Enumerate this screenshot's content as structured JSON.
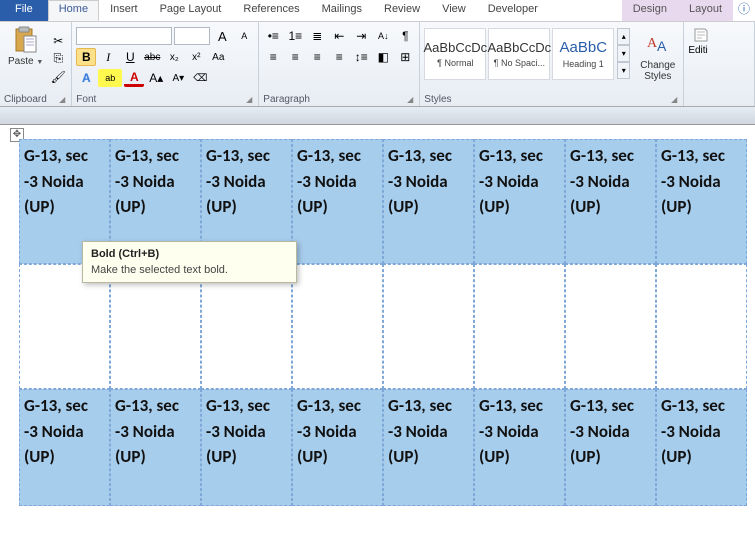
{
  "tabs": {
    "file": "File",
    "items": [
      "Home",
      "Insert",
      "Page Layout",
      "References",
      "Mailings",
      "Review",
      "View",
      "Developer"
    ],
    "context": [
      "Design",
      "Layout"
    ],
    "active": "Home",
    "help": "ⓘ"
  },
  "ribbon": {
    "clipboard": {
      "label": "Clipboard",
      "paste": "Paste",
      "cut": "✂",
      "copy": "⎘",
      "painter": "🖌"
    },
    "font": {
      "label": "Font",
      "name": "",
      "size": "",
      "grow": "A",
      "shrink": "A",
      "case": "Aa",
      "clear": "⌫",
      "bold": "B",
      "italic": "I",
      "underline": "U",
      "strike": "abc",
      "sub": "x₂",
      "sup": "x²",
      "effects": "A",
      "highlight": "ab",
      "color": "A"
    },
    "paragraph": {
      "label": "Paragraph",
      "bullets": "•≡",
      "numbers": "1≡",
      "multilevel": "≣",
      "dedent": "⇤",
      "indent": "⇥",
      "sort": "A↓",
      "marks": "¶",
      "left": "≡",
      "center": "≡",
      "right": "≡",
      "justify": "≡",
      "spacing": "↕≡",
      "shading": "◧",
      "borders": "⊞"
    },
    "styles": {
      "label": "Styles",
      "items": [
        {
          "preview": "AaBbCcDc",
          "name": "¶ Normal"
        },
        {
          "preview": "AaBbCcDc",
          "name": "¶ No Spaci..."
        },
        {
          "preview": "AaBbC",
          "name": "Heading 1"
        }
      ],
      "change": "Change\nStyles"
    },
    "editing": {
      "label": "Editi"
    }
  },
  "tooltip": {
    "title": "Bold (Ctrl+B)",
    "body": "Make the selected text bold."
  },
  "document": {
    "cell_text": "G-13, sec -3 Noida (UP)",
    "rows": [
      {
        "blank": false,
        "cells": 8
      },
      {
        "blank": true,
        "cells": 8
      },
      {
        "blank": false,
        "cells": 8
      }
    ],
    "move_handle": "✥"
  }
}
